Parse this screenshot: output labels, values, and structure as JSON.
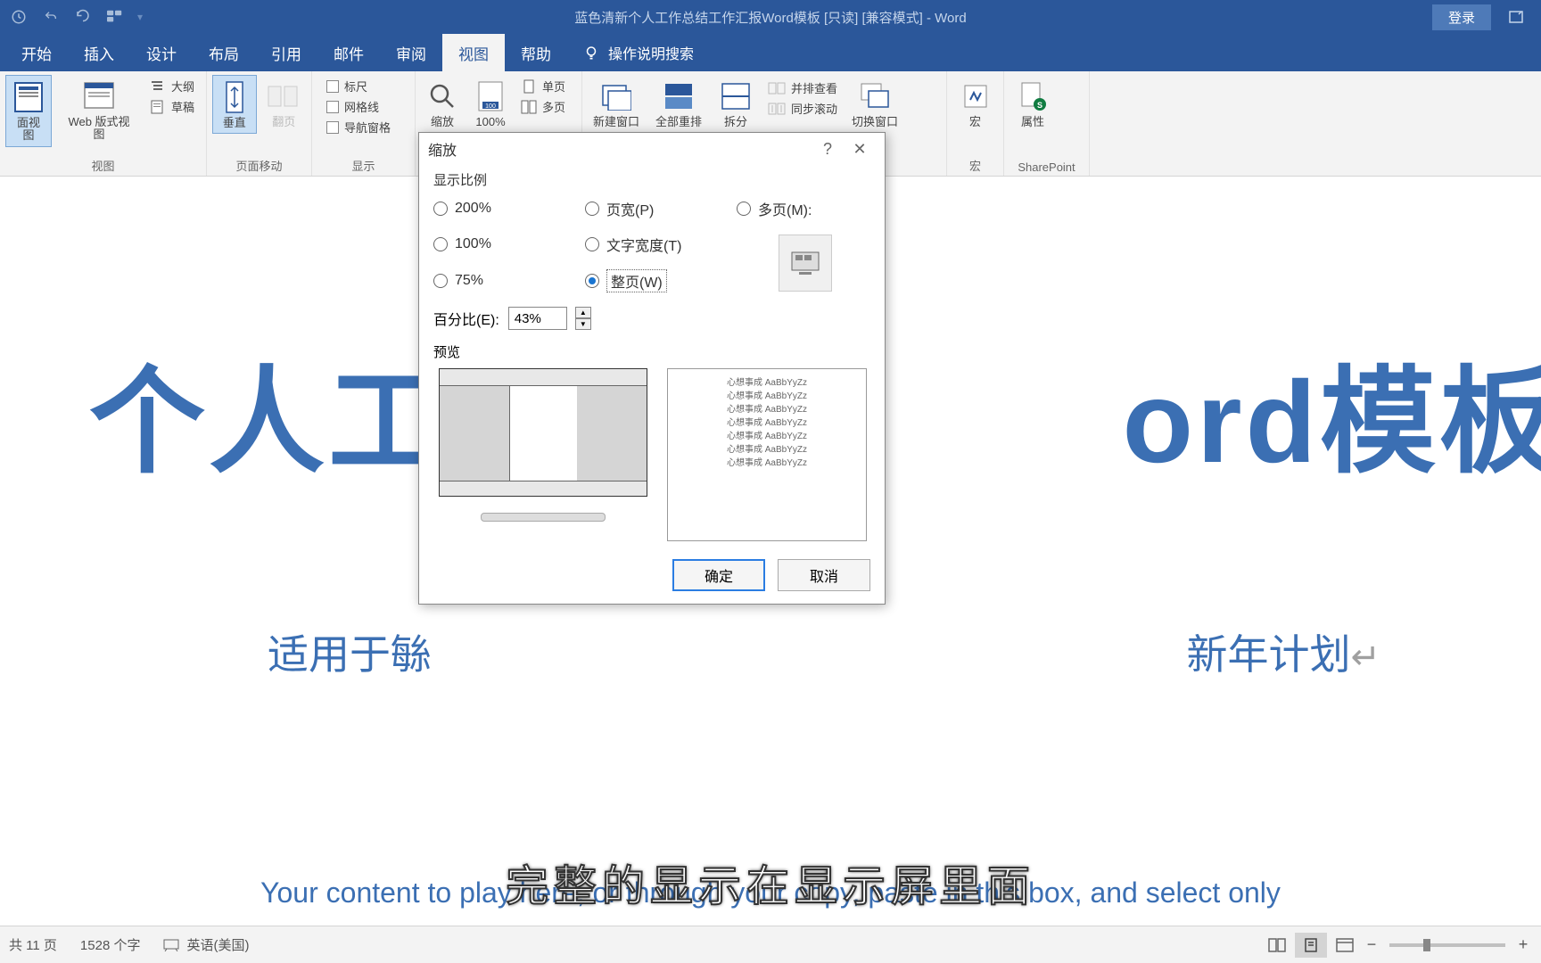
{
  "title_bar": {
    "document_title": "蓝色清新个人工作总结工作汇报Word模板 [只读] [兼容模式] - Word",
    "login": "登录"
  },
  "ribbon_tabs": {
    "start": "开始",
    "insert": "插入",
    "design": "设计",
    "layout": "布局",
    "references": "引用",
    "mail": "邮件",
    "review": "审阅",
    "view": "视图",
    "help": "帮助",
    "tell_me": "操作说明搜索"
  },
  "ribbon": {
    "views_group": {
      "page_view": "面视图",
      "web_view": "Web 版式视图",
      "outline": "大纲",
      "draft": "草稿",
      "label": "视图"
    },
    "page_move_group": {
      "vertical": "垂直",
      "flip": "翻页",
      "label": "页面移动"
    },
    "show_group": {
      "ruler": "标尺",
      "gridlines": "网格线",
      "nav_pane": "导航窗格",
      "label": "显示"
    },
    "zoom_group": {
      "zoom": "缩放",
      "hundred": "100%",
      "one_page": "单页",
      "multi_page": "多页"
    },
    "window_group": {
      "new_window": "新建窗口",
      "arrange_all": "全部重排",
      "split": "拆分",
      "side_by_side": "并排查看",
      "sync_scroll": "同步滚动",
      "switch_window": "切换窗口"
    },
    "macros_group": {
      "macros": "宏",
      "label": "宏"
    },
    "sharepoint_group": {
      "properties": "属性",
      "label": "SharePoint"
    }
  },
  "document": {
    "title_left": "个人工",
    "title_right": "ord模板",
    "subtitle_left": "适用于䋣",
    "subtitle_right": "新年计划",
    "content_text": "Your content to play here, or through your copy, paste in this box, and select only"
  },
  "dialog": {
    "title": "缩放",
    "section_ratio": "显示比例",
    "radio_200": "200%",
    "radio_100": "100%",
    "radio_75": "75%",
    "radio_page_width": "页宽(P)",
    "radio_text_width": "文字宽度(T)",
    "radio_whole_page": "整页(W)",
    "radio_many_pages": "多页(M):",
    "percent_label": "百分比(E):",
    "percent_value": "43%",
    "preview_label": "预览",
    "preview_text_line": "心想事成 AaBbYyZz",
    "ok": "确定",
    "cancel": "取消"
  },
  "status_bar": {
    "pages": "共 11 页",
    "words": "1528 个字",
    "language": "英语(美国)"
  },
  "caption": "完整的显示在显示屏里面"
}
